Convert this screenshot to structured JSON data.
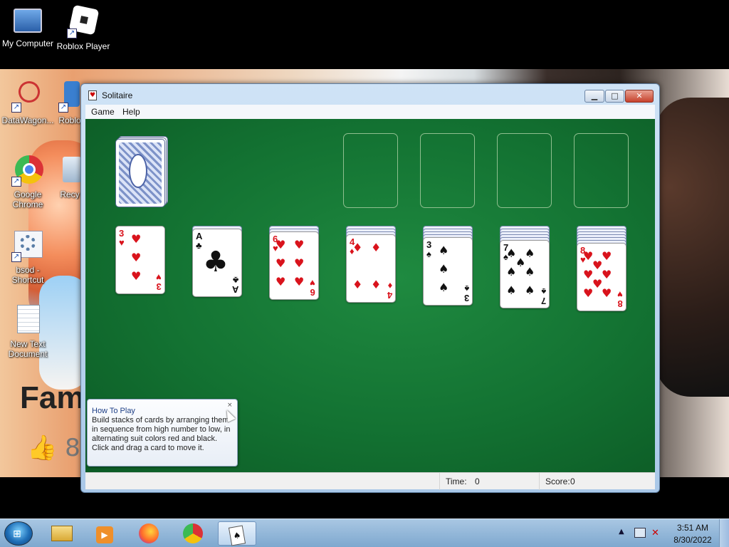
{
  "desktop": {
    "icons": [
      {
        "label": "My Computer",
        "icon": "computer-icon"
      },
      {
        "label": "Roblox Player",
        "icon": "roblox-icon"
      },
      {
        "label": "DataWagon...",
        "icon": "datawagon-icon"
      },
      {
        "label": "Roblo",
        "icon": "roblox-icon"
      },
      {
        "label": "Google Chrome",
        "icon": "chrome-icon"
      },
      {
        "label": "Recy",
        "icon": "recycle-bin-icon"
      },
      {
        "label": "bsod - Shortcut",
        "icon": "gears-icon"
      },
      {
        "label": "New Text Document",
        "icon": "text-document-icon"
      }
    ],
    "wallpaper_text": "Fam",
    "wallpaper_like_count": "8"
  },
  "window": {
    "title": "Solitaire",
    "menu": [
      "Game",
      "Help"
    ],
    "status": {
      "time_label": "Time:",
      "time_value": "0",
      "score_label": "Score:",
      "score_value": "0"
    }
  },
  "game": {
    "stock": {
      "face": "down"
    },
    "foundations": [
      {
        "empty": true
      },
      {
        "empty": true
      },
      {
        "empty": true
      },
      {
        "empty": true
      }
    ],
    "tableau": [
      {
        "hidden_count": 0,
        "top": {
          "rank": "3",
          "suit": "♥",
          "color": "red"
        }
      },
      {
        "hidden_count": 1,
        "top": {
          "rank": "A",
          "suit": "♣",
          "color": "black"
        }
      },
      {
        "hidden_count": 2,
        "top": {
          "rank": "6",
          "suit": "♥",
          "color": "red"
        }
      },
      {
        "hidden_count": 3,
        "top": {
          "rank": "4",
          "suit": "♦",
          "color": "red"
        }
      },
      {
        "hidden_count": 4,
        "top": {
          "rank": "3",
          "suit": "♠",
          "color": "black"
        }
      },
      {
        "hidden_count": 5,
        "top": {
          "rank": "7",
          "suit": "♠",
          "color": "black"
        }
      },
      {
        "hidden_count": 6,
        "top": {
          "rank": "8",
          "suit": "♥",
          "color": "red"
        }
      }
    ]
  },
  "help_popup": {
    "title": "How To Play",
    "body": "Build stacks of cards by arranging them in sequence from high number to low, in alternating suit colors red and black. Click and drag a card to move it.",
    "close": "×"
  },
  "taskbar": {
    "apps": [
      "explorer-icon",
      "media-player-icon",
      "firefox-icon",
      "chrome-icon",
      "solitaire-icon"
    ],
    "active_app": "solitaire-icon",
    "clock_time": "3:51 AM",
    "clock_date": "8/30/2022"
  },
  "colors": {
    "felt": "#137232",
    "red_suit": "#d9131c",
    "black_suit": "#111111",
    "taskbar": "#8fb4d8"
  }
}
